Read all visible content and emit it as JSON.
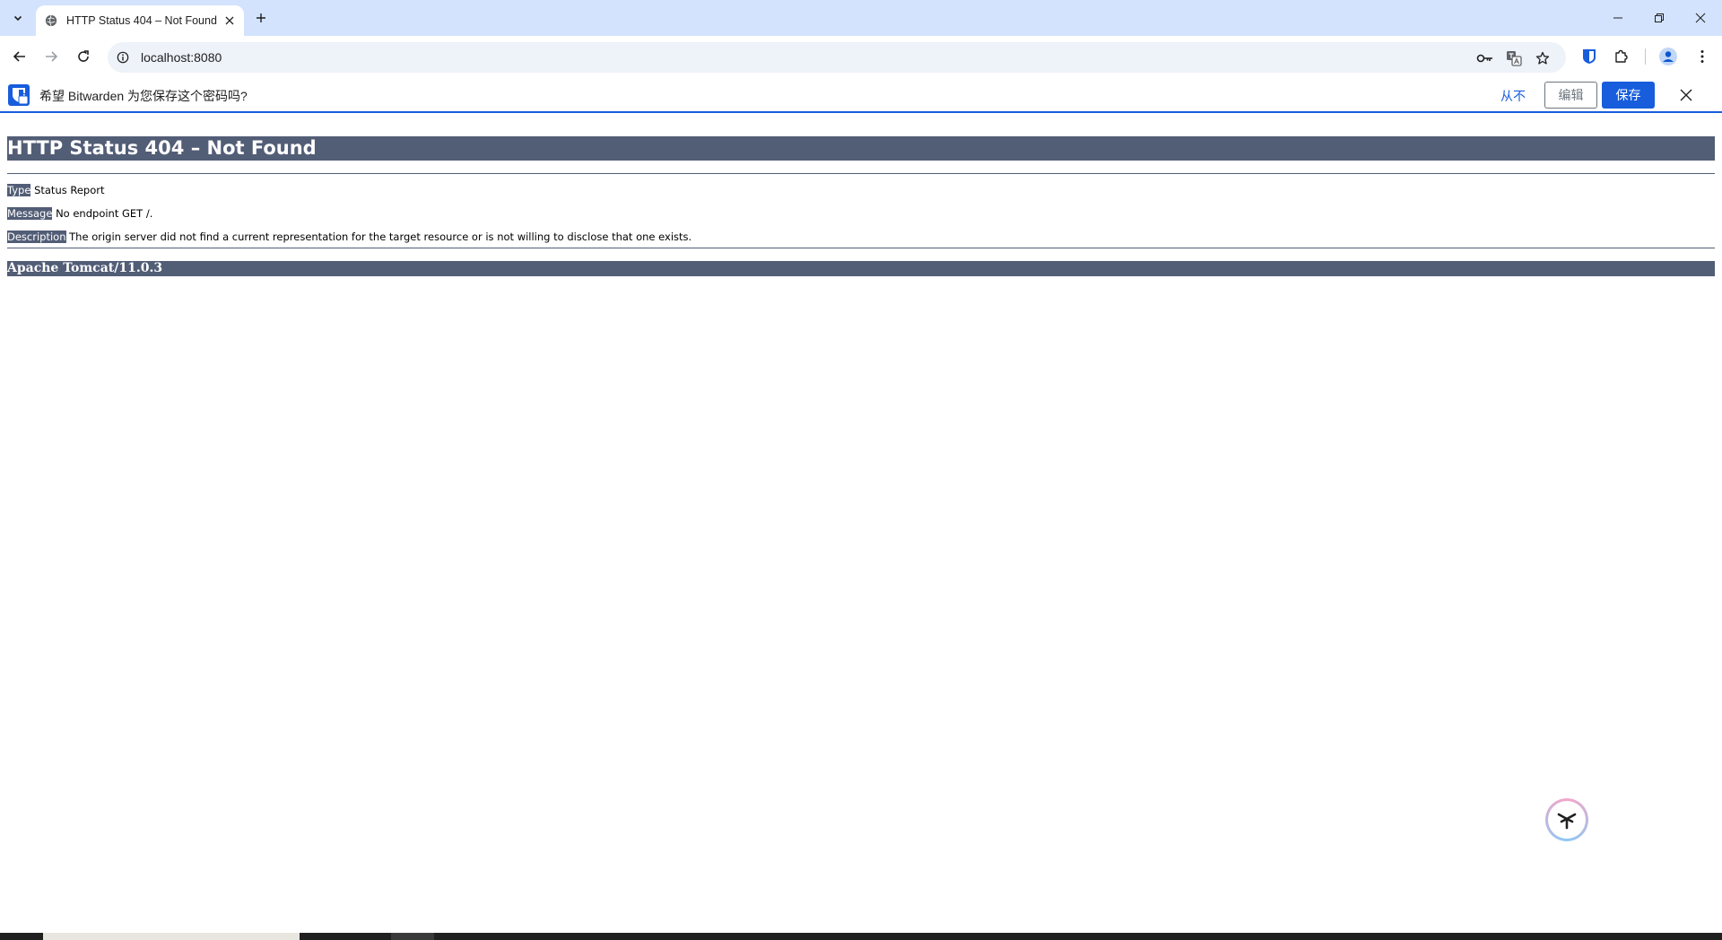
{
  "browser": {
    "tab": {
      "title": "HTTP Status 404 – Not Found"
    },
    "address": {
      "url": "localhost:8080"
    }
  },
  "bitwarden": {
    "prompt": "希望 Bitwarden 为您保存这个密码吗?",
    "never_label": "从不",
    "edit_label": "编辑",
    "save_label": "保存",
    "brand_color": "#175ddc"
  },
  "page": {
    "title": "HTTP Status 404 – Not Found",
    "rows": [
      {
        "label": "Type",
        "value": "Status Report"
      },
      {
        "label": "Message",
        "value": "No endpoint GET /."
      },
      {
        "label": "Description",
        "value": "The origin server did not find a current representation for the target resource or is not willing to disclose that one exists."
      }
    ],
    "footer": "Apache Tomcat/11.0.3",
    "header_color": "#525d76"
  },
  "icons": {
    "tab_search": "chevron-down-icon",
    "favicon": "globe-icon",
    "new_tab": "plus-icon",
    "back": "arrow-left-icon",
    "forward": "arrow-right-icon",
    "reload": "reload-icon",
    "site_info": "info-icon",
    "passwords": "key-icon",
    "translate": "translate-icon",
    "bookmark": "star-icon",
    "extensions": "puzzle-icon",
    "profile": "person-icon",
    "menu": "kebab-icon"
  }
}
